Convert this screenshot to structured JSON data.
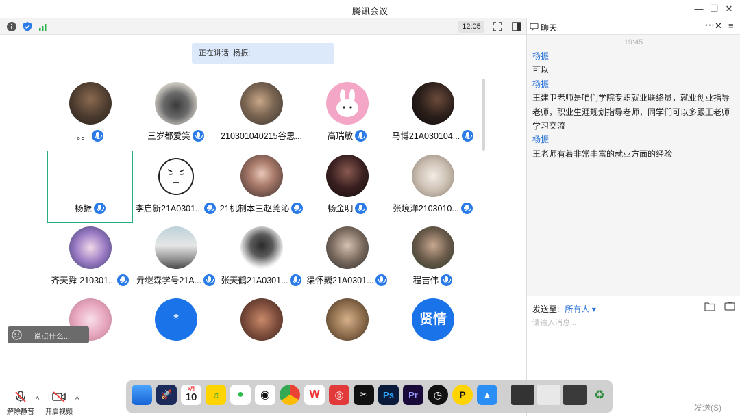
{
  "window": {
    "title": "腾讯会议"
  },
  "toolbar": {
    "time": "12:05"
  },
  "speaking": {
    "text": "正在讲话: 杨振;"
  },
  "participants": [
    {
      "name": "。。"
    },
    {
      "name": "三岁都爱笑"
    },
    {
      "name": "210301040215谷思..."
    },
    {
      "name": "高瑞敏"
    },
    {
      "name": "马博21A030104..."
    },
    {
      "name": "杨振"
    },
    {
      "name": "李启新21A0301..."
    },
    {
      "name": "21机制本三赵莞沁"
    },
    {
      "name": "杨金明"
    },
    {
      "name": "张境洋2103010..."
    },
    {
      "name": "齐天舜-210301..."
    },
    {
      "name": "亓继森学号21A..."
    },
    {
      "name": "张天鹤21A0301..."
    },
    {
      "name": "渠怀巍21A0301..."
    },
    {
      "name": "程吉伟"
    }
  ],
  "avatar_glyphs": {
    "star": "*",
    "xianqing": "贤情"
  },
  "chat": {
    "title": "聊天",
    "time": "19:45",
    "messages": [
      {
        "sender": "杨振",
        "text": "可以"
      },
      {
        "sender": "杨振",
        "text": "王建卫老师是咱们学院专职就业联络员，就业创业指导老师，职业生涯规划指导老师，同学们可以多跟王老师学习交流"
      },
      {
        "sender": "杨振",
        "text": "王老师有着非常丰富的就业方面的经验"
      }
    ],
    "send_to_label": "发送至:",
    "recipient": "所有人",
    "input_placeholder": "请输入消息...",
    "send_button": "发送(S)"
  },
  "float_input": {
    "placeholder": "说点什么..."
  },
  "controls": {
    "unmute": "解除静音",
    "start_video": "开启视频"
  },
  "dock": {
    "calendar_month": "5月",
    "calendar_day": "10"
  },
  "colors": {
    "accent": "#2a7be8",
    "selected_border": "#27ae7a",
    "sender": "#2a72d8"
  }
}
